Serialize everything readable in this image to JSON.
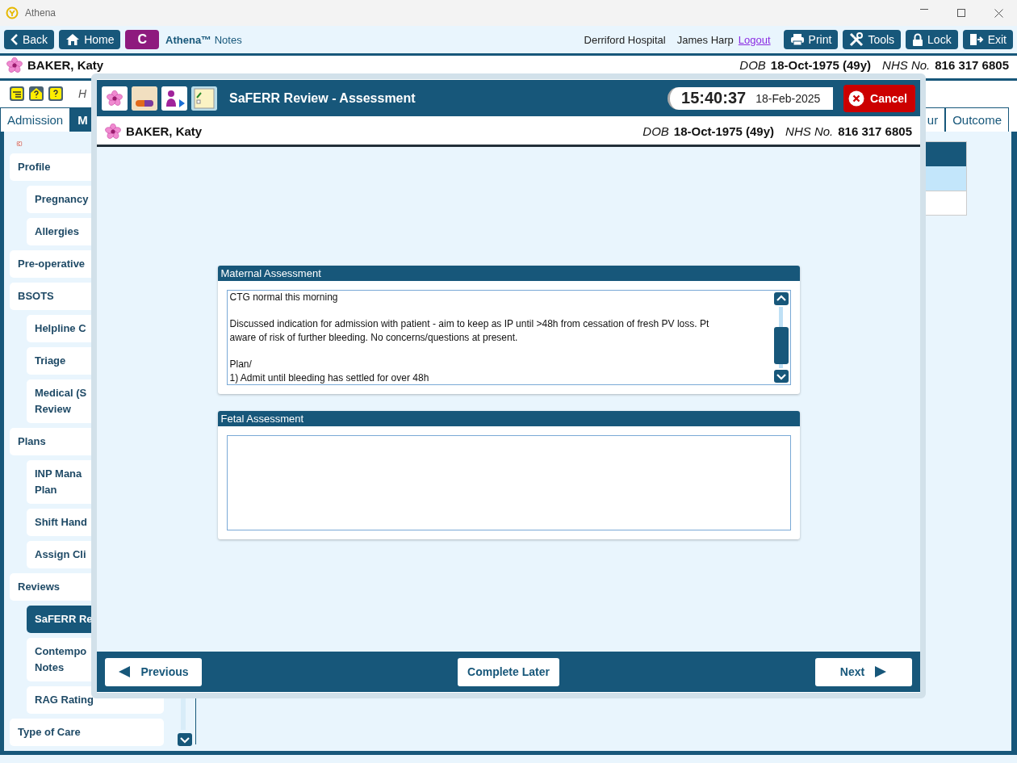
{
  "window": {
    "title": "Athena"
  },
  "toolbar": {
    "nav": [
      {
        "kind": "back",
        "label": "Back"
      },
      {
        "kind": "home",
        "label": "Home"
      },
      {
        "kind": "letter",
        "label": "C"
      }
    ],
    "app_title": "**Athena™** Notes",
    "hospital": "Derriford Hospital",
    "user": "James Harp",
    "logout": "Logout",
    "actions": [
      {
        "kind": "print",
        "label": "Print"
      },
      {
        "kind": "tools",
        "label": "Tools"
      },
      {
        "kind": "lock",
        "label": "Lock"
      },
      {
        "kind": "exit",
        "label": "Exit"
      }
    ]
  },
  "patient": {
    "name": "BAKER, Katy",
    "dob_label": "DOB",
    "dob": "18-Oct-1975 (49y)",
    "nhs_label": "NHS No.",
    "nhs": "816 317 6805"
  },
  "header_row": {
    "text": "H"
  },
  "tabs": [
    {
      "label": "Admission",
      "selected": false
    },
    {
      "label": "M",
      "selected": true
    },
    {
      "label": "ur",
      "selected": false
    },
    {
      "label": "Outcome",
      "selected": false
    }
  ],
  "sidebar": {
    "items": [
      {
        "label": "Profile",
        "selected": false,
        "children": [
          {
            "label": "Pregnancy",
            "selected": false
          },
          {
            "label": "Allergies",
            "selected": false
          }
        ]
      },
      {
        "label": "Pre-operative",
        "selected": false
      },
      {
        "label": "BSOTS",
        "selected": false,
        "children": [
          {
            "label": "Helpline C",
            "selected": false
          },
          {
            "label": "Triage",
            "selected": false
          },
          {
            "label": "Medical (S\nReview",
            "selected": false
          }
        ]
      },
      {
        "label": "Plans",
        "selected": false,
        "children": [
          {
            "label": "INP Mana\nPlan",
            "selected": false
          },
          {
            "label": "Shift Hand",
            "selected": false
          },
          {
            "label": "Assign Cli",
            "selected": false
          }
        ]
      },
      {
        "label": "Reviews",
        "selected": false,
        "children": [
          {
            "label": "SaFERR Re",
            "selected": true
          },
          {
            "label": "Contempo\nNotes",
            "selected": false
          },
          {
            "label": "RAG Rating",
            "selected": false
          }
        ]
      },
      {
        "label": "Type of Care",
        "selected": false
      }
    ]
  },
  "dialog": {
    "title": "SaFERR Review - Assessment",
    "time": "15:40:37",
    "date": "18-Feb-2025",
    "cancel": "Cancel",
    "patient": {
      "name": "BAKER, Katy",
      "dob_label": "DOB",
      "dob": "18-Oct-1975 (49y)",
      "nhs_label": "NHS No.",
      "nhs": "816 317 6805"
    },
    "sections": [
      {
        "title": "Maternal Assessment",
        "value": "CTG normal this morning\n\nDiscussed indication for admission with patient - aim to keep as IP until >48h from cessation of fresh PV loss. Pt\naware of risk of further bleeding. No concerns/questions at present.\n\nPlan/\n1) Admit until bleeding has settled for over 48h",
        "scrollbar": true
      },
      {
        "title": "Fetal Assessment",
        "scrollbar": false
      }
    ],
    "footer": {
      "previous": "Previous",
      "complete_later": "Complete Later",
      "next": "Next"
    }
  }
}
